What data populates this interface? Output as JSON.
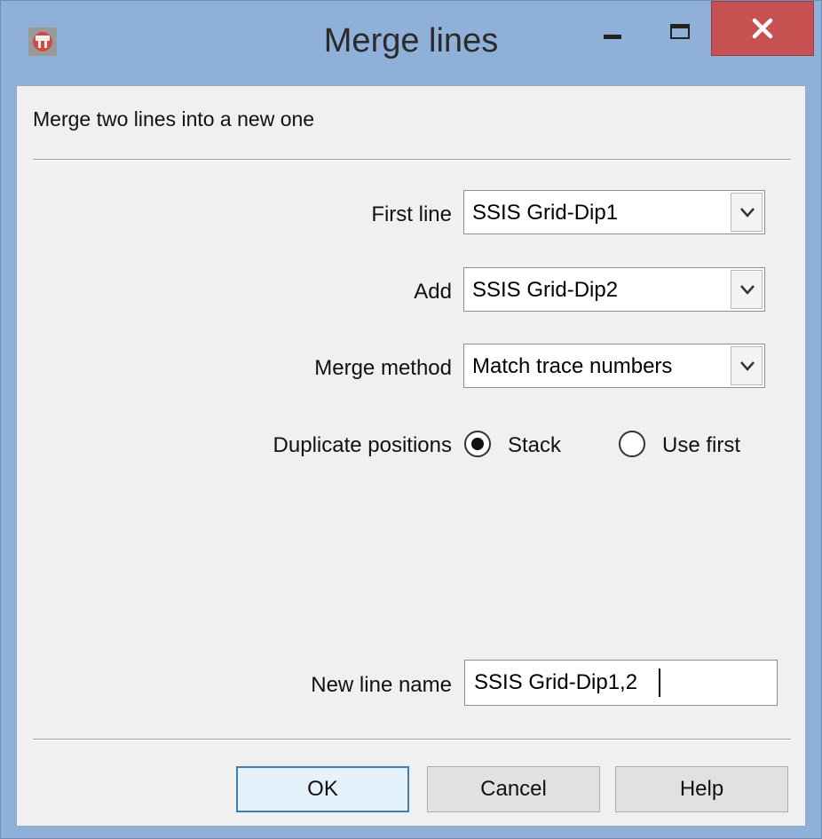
{
  "window": {
    "title": "Merge lines",
    "icon": "app-icon",
    "controls": {
      "minimize": "minimize-icon",
      "maximize": "maximize-icon",
      "close": "close-icon"
    },
    "colors": {
      "frame": "#8fb0d8",
      "close": "#c75050",
      "client": "#f0f0f0"
    }
  },
  "dialog": {
    "description": "Merge two lines into a new one",
    "first_line": {
      "label": "First line",
      "value": "SSIS Grid-Dip1"
    },
    "add": {
      "label": "Add",
      "value": "SSIS Grid-Dip2"
    },
    "merge_method": {
      "label": "Merge method",
      "value": "Match trace numbers"
    },
    "duplicate_positions": {
      "label": "Duplicate positions",
      "options": [
        "Stack",
        "Use first"
      ],
      "selected": "Stack"
    },
    "new_line_name": {
      "label": "New line name",
      "value": "SSIS Grid-Dip1,2"
    }
  },
  "buttons": {
    "ok": "OK",
    "cancel": "Cancel",
    "help": "Help"
  }
}
